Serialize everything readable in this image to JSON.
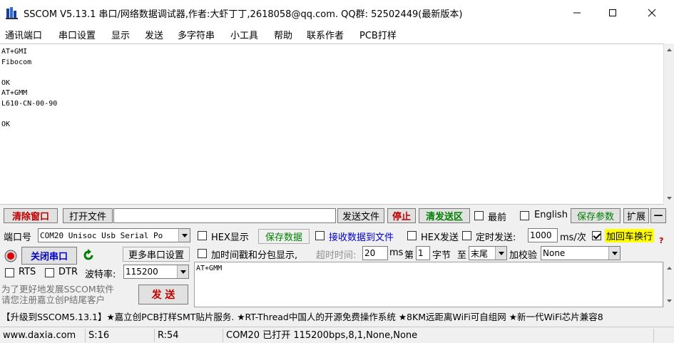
{
  "window": {
    "title": "SSCOM V5.13.1 串口/网络数据调试器,作者:大虾丁丁,2618058@qq.com. QQ群: 52502449(最新版本)",
    "minimize": "—",
    "maximize": "☐",
    "close": "✕"
  },
  "menu": [
    "通讯端口",
    "串口设置",
    "显示",
    "发送",
    "多字符串",
    "小工具",
    "帮助",
    "联系作者",
    "PCB打样"
  ],
  "receive": {
    "text": "AT+GMI\nFibocom\n\nOK\nAT+GMM\nL610-CN-00-90\n\nOK"
  },
  "toolbar": {
    "clear_window": "清除窗口",
    "open_file": "打开文件",
    "file_path": "",
    "send_file": "发送文件",
    "stop": "停止",
    "clear_send": "清发送区",
    "topmost": "最前",
    "english": "English",
    "save_params": "保存参数",
    "expand": "扩展",
    "collapse": "—"
  },
  "port": {
    "port_label": "端口号",
    "port_value": "COM20 Unisoc Usb Serial Po",
    "hex_display": "HEX显示",
    "save_data": "保存数据",
    "recv_to_file": "接收数据到文件",
    "hex_send": "HEX发送",
    "timed_send": "定时发送:",
    "interval": "1000",
    "interval_unit": "ms/次",
    "add_crlf": "加回车换行",
    "help_mark": "?"
  },
  "conn": {
    "close_port": "关闭串口",
    "more_settings": "更多串口设置",
    "add_timestamp": "加时间戳和分包显示,",
    "timeout_label": "超时时间:",
    "timeout_value": "20",
    "timeout_unit": "ms",
    "nth_label": "第",
    "nth_value": "1",
    "byte_label": "字节",
    "to_label": "至",
    "end_value": "末尾",
    "checksum_label": "加校验",
    "checksum_value": "None"
  },
  "serial": {
    "rts": "RTS",
    "dtr": "DTR",
    "baud_label": "波特率:",
    "baud_value": "115200"
  },
  "promo": {
    "line1": "为了更好地发展SSCOM软件",
    "line2": "请您注册嘉立创P结尾客户",
    "send_button": "发  送"
  },
  "send": {
    "text": "AT+GMM"
  },
  "ticker": "【升级到SSCOM5.13.1】★嘉立创PCB打样SMT贴片服务. ★RT-Thread中国人的开源免费操作系统 ★8KM远距离WiFi可自组网 ★新一代WiFi芯片兼容8",
  "status": {
    "website": "www.daxia.com",
    "sent": "S:16",
    "received": "R:54",
    "port_state": "COM20 已打开  115200bps,8,1,None,None"
  },
  "colors": {
    "accent_red": "#c00000",
    "accent_green": "#008000",
    "crlf_highlight": "#ffff00"
  }
}
